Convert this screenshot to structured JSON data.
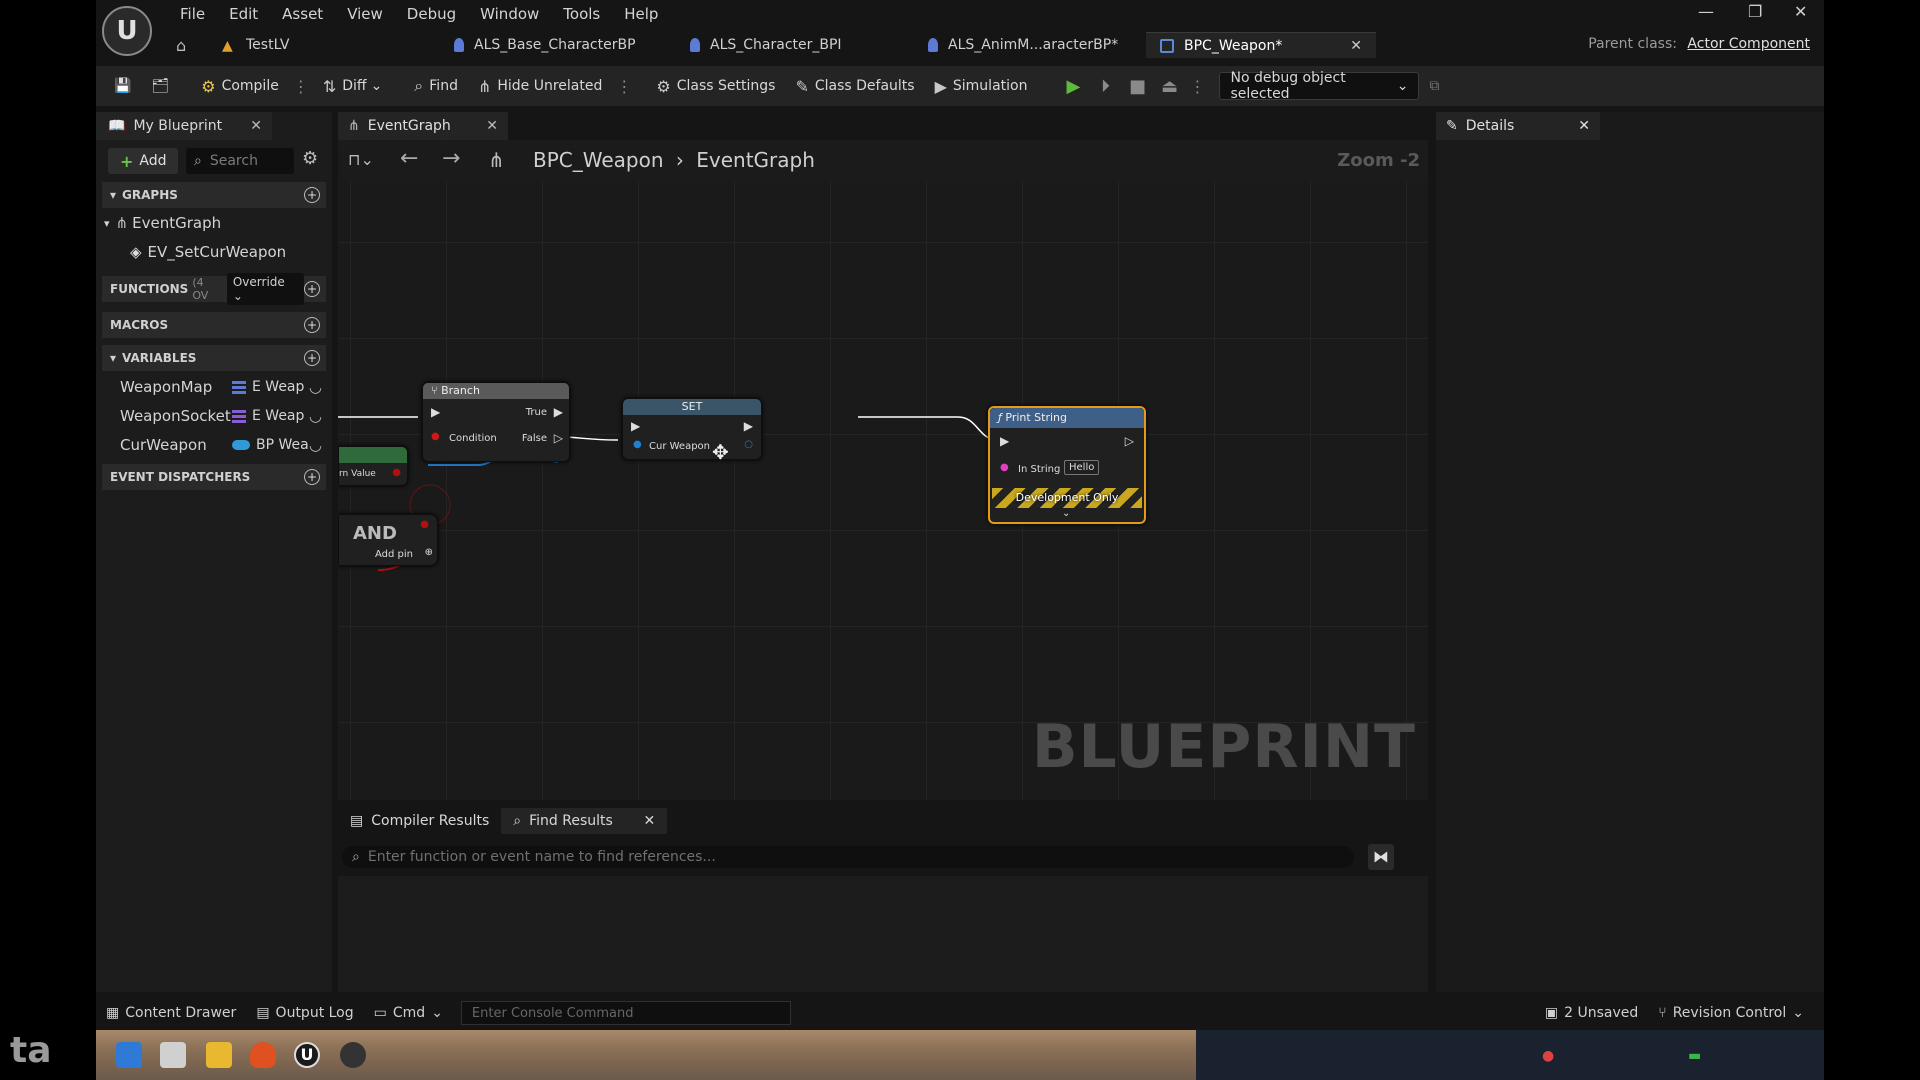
{
  "menu": [
    "File",
    "Edit",
    "Asset",
    "View",
    "Debug",
    "Window",
    "Tools",
    "Help"
  ],
  "tabs": [
    {
      "label": "TestLV",
      "icon": "level-icon"
    },
    {
      "label": "ALS_Base_CharacterBP",
      "icon": "character-icon"
    },
    {
      "label": "ALS_Character_BPI",
      "icon": "interface-icon"
    },
    {
      "label": "ALS_AnimM...aracterBP*",
      "icon": "anim-icon"
    },
    {
      "label": "BPC_Weapon*",
      "icon": "blueprint-icon"
    }
  ],
  "parent_class": {
    "label": "Parent class:",
    "value": "Actor Component"
  },
  "toolbar": {
    "compile": "Compile",
    "diff": "Diff",
    "find": "Find",
    "hide_unrelated": "Hide Unrelated",
    "class_settings": "Class Settings",
    "class_defaults": "Class Defaults",
    "simulation": "Simulation",
    "debug_object": "No debug object selected"
  },
  "my_blueprint": {
    "tab": "My Blueprint",
    "add": "Add",
    "search_placeholder": "Search",
    "graphs_header": "GRAPHS",
    "event_graph": "EventGraph",
    "event": "EV_SetCurWeapon",
    "functions_header": "FUNCTIONS",
    "functions_count": "(4 OV",
    "override": "Override",
    "macros_header": "MACROS",
    "variables_header": "VARIABLES",
    "variables": [
      {
        "name": "WeaponMap",
        "type": "E Weap",
        "color": "#5b7bd6"
      },
      {
        "name": "WeaponSocket",
        "type": "E Weap",
        "color": "#8a5bd6"
      },
      {
        "name": "CurWeapon",
        "type": "BP Wea",
        "color": "#2f9ad6"
      }
    ],
    "dispatchers_header": "EVENT DISPATCHERS"
  },
  "graph": {
    "tab": "EventGraph",
    "crumb_root": "BPC_Weapon",
    "crumb_leaf": "EventGraph",
    "zoom": "Zoom -2",
    "watermark": "BLUEPRINT",
    "branch": {
      "title": "Branch",
      "true": "True",
      "condition": "Condition",
      "false": "False"
    },
    "set": {
      "title": "SET",
      "pin": "Cur Weapon"
    },
    "print": {
      "title": "Print String",
      "in_string": "In String",
      "value": "Hello",
      "dev": "Development Only"
    },
    "return_pin": "rn Value",
    "and": {
      "title": "AND",
      "add_pin": "Add pin"
    }
  },
  "bottom": {
    "compiler": "Compiler Results",
    "find": "Find Results",
    "find_placeholder": "Enter function or event name to find references..."
  },
  "details": {
    "tab": "Details"
  },
  "status": {
    "content_drawer": "Content Drawer",
    "output_log": "Output Log",
    "cmd": "Cmd",
    "console_placeholder": "Enter Console Command",
    "unsaved": "2 Unsaved",
    "revision": "Revision Control"
  },
  "taskbar_logo": "ta"
}
